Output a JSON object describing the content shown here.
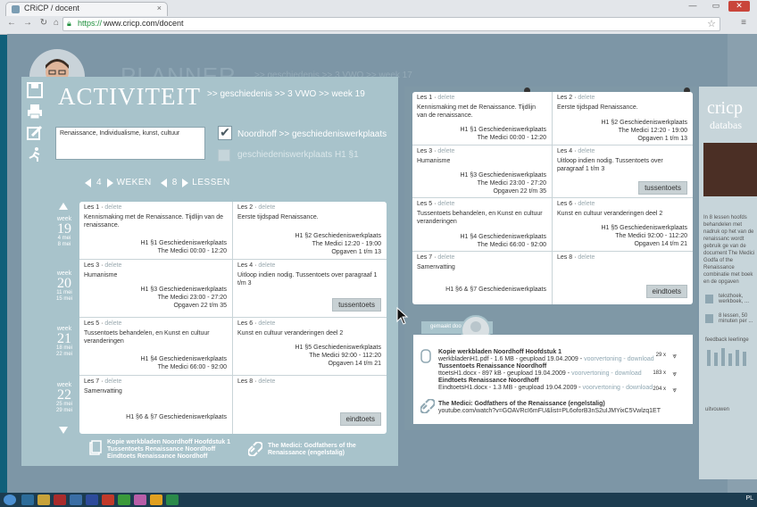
{
  "browser": {
    "tab_title": "CRiCP / docent",
    "url": "https://www.cricp.com/docent",
    "url_protocol": "https://",
    "url_host": "www.cricp.com/docent"
  },
  "background": {
    "title": "PLANNER",
    "breadcrumb": ">> geschiedenis >> 3 VWO >> week 17",
    "right_text": "Cl"
  },
  "activity": {
    "title": "ACTIVITEIT",
    "breadcrumb": ">> geschiedenis >> 3 VWO >> week 19",
    "tags": "Renaissance, Individualisme, kunst, cultuur",
    "source1": "Noordhoff >> geschiedeniswerkplaats",
    "source2": "geschiedeniswerkplaats H1 §1",
    "weeks_count": "4",
    "weeks_label": "WEKEN",
    "lessons_count": "8",
    "lessons_label": "LESSEN",
    "weeks": [
      {
        "w": "week",
        "n": "19",
        "d1": "4 mei",
        "d2": "8 mei"
      },
      {
        "w": "week",
        "n": "20",
        "d1": "11 mei",
        "d2": "15 mei"
      },
      {
        "w": "week",
        "n": "21",
        "d1": "18 mei",
        "d2": "22 mei"
      },
      {
        "w": "week",
        "n": "22",
        "d1": "25 mei",
        "d2": "29 mei"
      }
    ],
    "lessons": [
      {
        "head": "Les 1",
        "del": "delete",
        "text": "Kennismaking met de Renaissance. Tijdlijn van de renaissance.",
        "r1": "H1 §1 Geschiedeniswerkplaats",
        "r2": "The Medici 00:00 - 12:20",
        "r3": ""
      },
      {
        "head": "Les 2",
        "del": "delete",
        "text": "Eerste tijdspad Renaissance.",
        "r1": "H1 §2 Geschiedeniswerkplaats",
        "r2": "The Medici 12:20 - 19:00",
        "r3": "Opgaven 1 t/m 13"
      },
      {
        "head": "Les 3",
        "del": "delete",
        "text": "Humanisme",
        "r1": "H1 §3 Geschiedeniswerkplaats",
        "r2": "The Medici 23:00 - 27:20",
        "r3": "Opgaven 22 t/m 35"
      },
      {
        "head": "Les 4",
        "del": "delete",
        "text": "Uitloop indien nodig. Tussentoets over paragraaf 1 t/m 3",
        "r1": "",
        "r2": "",
        "r3": ""
      },
      {
        "head": "Les 5",
        "del": "delete",
        "text": "Tussentoets behandelen, en Kunst en cultuur veranderingen",
        "r1": "H1 §4 Geschiedeniswerkplaats",
        "r2": "The Medici 66:00 - 92:00",
        "r3": ""
      },
      {
        "head": "Les 6",
        "del": "delete",
        "text": "Kunst en cultuur veranderingen deel 2",
        "r1": "H1 §5 Geschiedeniswerkplaats",
        "r2": "The Medici 92:00 - 112:20",
        "r3": "Opgaven 14 t/m 21"
      },
      {
        "head": "Les 7",
        "del": "delete",
        "text": "Samenvatting",
        "r1": "H1 §6 & §7 Geschiedeniswerkplaats",
        "r2": "",
        "r3": ""
      },
      {
        "head": "Les 8",
        "del": "delete",
        "text": "",
        "r1": "",
        "r2": "",
        "r3": ""
      }
    ],
    "tussentoets": "tussentoets",
    "eindtoets": "eindtoets",
    "strip_files": "Kopie werkbladen Noordhoff Hoofdstuk 1\nTussentoets Renaissance Noordhoff\nEindtoets Renaissance Noordhoff",
    "strip_video": "The Medici: Godfathers of the Renaissance (engelstalig)"
  },
  "detail": {
    "made_by": "gemaakt door",
    "files": [
      {
        "title": "Kopie werkbladen Noordhoff Hoofdstuk 1",
        "meta": "werkbladenH1.pdf - 1.6 MB - geupload 19.04.2009 -",
        "actions": "voorvertoning - download",
        "size": "29 x"
      },
      {
        "title": "Tussentoets Renaissance Noordhoff",
        "meta": "ttoetsH1.docx - 897 kB - geupload 19.04.2009 -",
        "actions": "voorvertoning - download",
        "size": "183 x"
      },
      {
        "title": "Eindtoets Renaissance Noordhoff",
        "meta": "EindtoetsH1.docx - 1.3 MB - geupload 19.04.2009 -",
        "actions": "voorvertoning - download",
        "size": "204 x"
      }
    ],
    "video_title": "The Medici: Godfathers of the Renaissance (engelstalig)",
    "video_url": "youtube.com/watch?v=GOAVRcI6mFU&list=PL6oforB3nS2uIJMYixC5Vwlzq1ET"
  },
  "cricp": {
    "title": "cricp",
    "subtitle": "databas",
    "text": "In 8 lessen hoofds behandelen met nadruk op het van de renaissanc wordt gebruik ge van de document The Medici Godfa of the Renaissance combinatie met boek en de opgaven",
    "tag1": "teksthoek, werkboek, ...",
    "tag2": "8 lessen, 50 minuten per ...",
    "feedback": "feedback leerlinge",
    "expand": "uitvouwen"
  },
  "taskbar": {
    "lang": "PL"
  }
}
